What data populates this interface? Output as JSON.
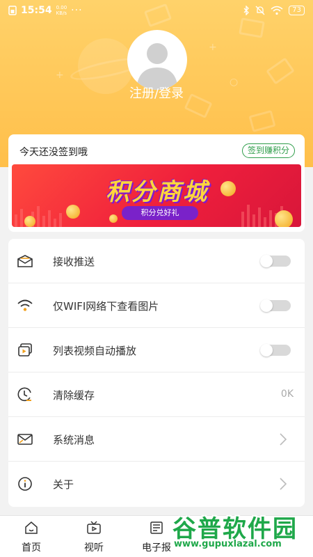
{
  "status_bar": {
    "time": "15:54",
    "net_speed": "0.00",
    "net_unit": "KB/s",
    "more": "···",
    "battery": "73"
  },
  "profile": {
    "login_text": "注册/登录"
  },
  "sign_card": {
    "prompt": "今天还没签到哦",
    "button": "签到赚积分",
    "banner_title": "积分商城",
    "banner_subtitle": "积分兑好礼"
  },
  "settings": {
    "items": [
      {
        "label": "接收推送",
        "icon": "envelope-open-icon",
        "control": "toggle",
        "on": false
      },
      {
        "label": "仅WIFI网络下查看图片",
        "icon": "wifi-icon",
        "control": "toggle",
        "on": false
      },
      {
        "label": "列表视频自动播放",
        "icon": "video-play-icon",
        "control": "toggle",
        "on": false
      },
      {
        "label": "清除缓存",
        "icon": "clock-clean-icon",
        "control": "value",
        "value": "0K"
      },
      {
        "label": "系统消息",
        "icon": "mail-icon",
        "control": "chevron"
      },
      {
        "label": "关于",
        "icon": "info-icon",
        "control": "chevron"
      }
    ]
  },
  "tabbar": {
    "tabs": [
      {
        "label": "首页",
        "icon": "home-icon"
      },
      {
        "label": "视听",
        "icon": "tv-icon"
      },
      {
        "label": "电子报",
        "icon": "newspaper-icon"
      }
    ]
  },
  "watermark": {
    "text": "谷普软件园",
    "url": "www.gupuxlazal.com"
  },
  "colors": {
    "header": "#ffc54f",
    "accent_green": "#2e9d4a",
    "banner_red": "#ef1f3c",
    "banner_purple": "#7a22c9",
    "banner_gold": "#ffd63c"
  }
}
